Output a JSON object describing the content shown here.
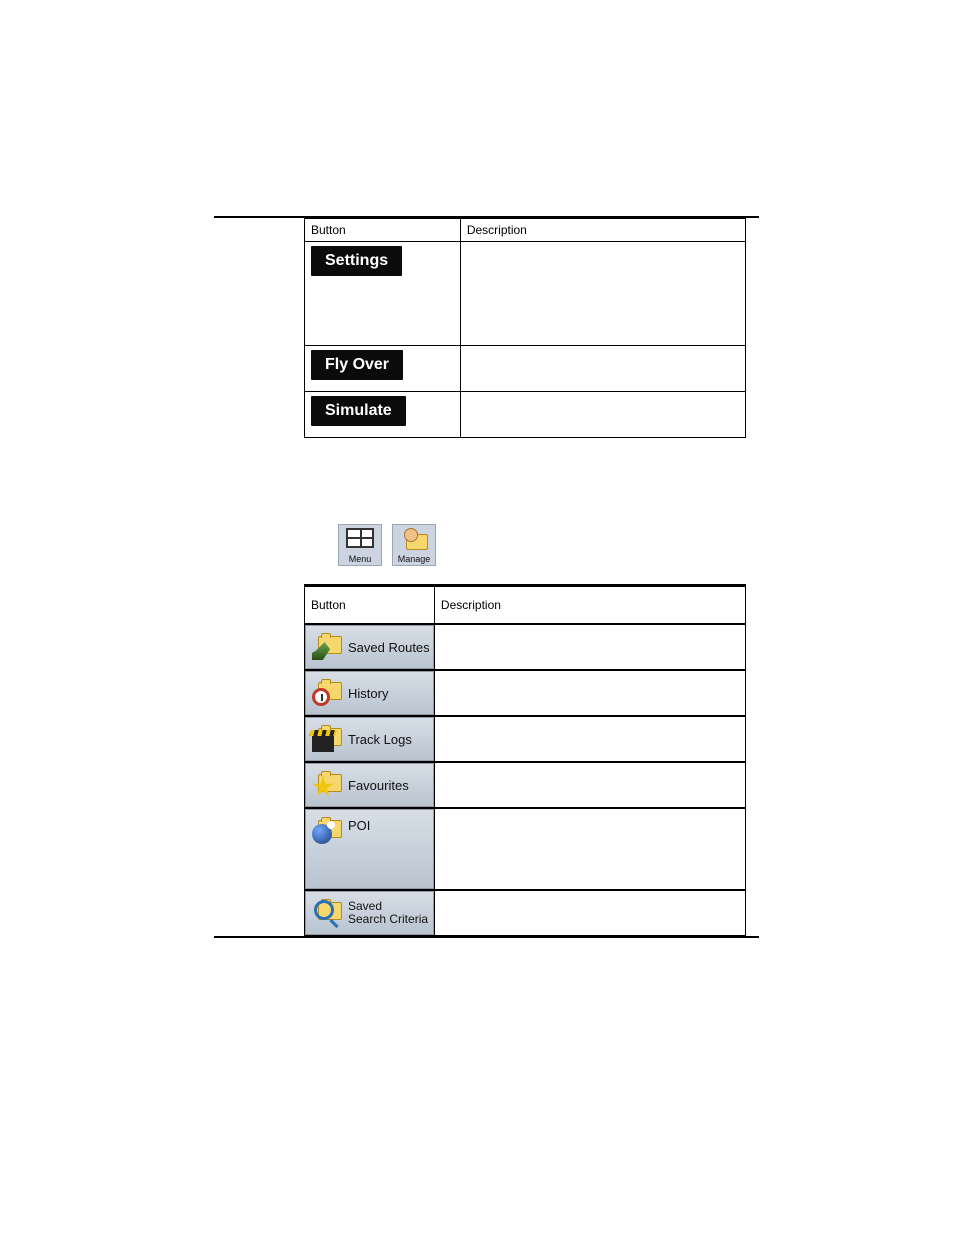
{
  "table1": {
    "header_button": "Button",
    "header_desc": "Description",
    "rows": [
      {
        "label": "Settings",
        "desc": ""
      },
      {
        "label": "Fly Over",
        "desc": ""
      },
      {
        "label": "Simulate",
        "desc": ""
      }
    ]
  },
  "mid_icons": {
    "menu": "Menu",
    "manage": "Manage"
  },
  "table2": {
    "header_button": "Button",
    "header_desc": "Description",
    "rows": [
      {
        "label": "Saved Routes",
        "desc": ""
      },
      {
        "label": "History",
        "desc": ""
      },
      {
        "label": "Track Logs",
        "desc": ""
      },
      {
        "label": "Favourites",
        "desc": ""
      },
      {
        "label": "POI",
        "desc": ""
      },
      {
        "label_line1": "Saved",
        "label_line2": "Search Criteria",
        "desc": ""
      }
    ]
  }
}
